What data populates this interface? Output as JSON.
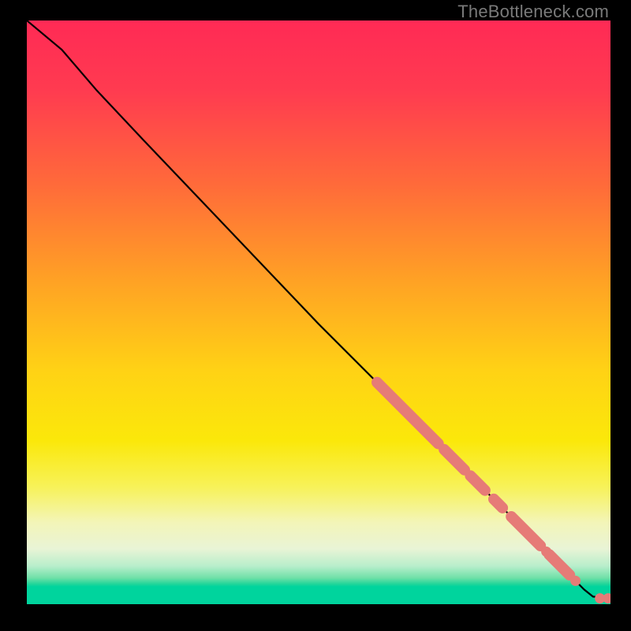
{
  "watermark": "TheBottleneck.com",
  "colors": {
    "gradient_stops": [
      {
        "offset": 0.0,
        "color": "#ff2a55"
      },
      {
        "offset": 0.12,
        "color": "#ff3b50"
      },
      {
        "offset": 0.28,
        "color": "#ff6a3a"
      },
      {
        "offset": 0.45,
        "color": "#ffa324"
      },
      {
        "offset": 0.6,
        "color": "#ffd215"
      },
      {
        "offset": 0.72,
        "color": "#fbe80a"
      },
      {
        "offset": 0.8,
        "color": "#f7f25a"
      },
      {
        "offset": 0.86,
        "color": "#f3f5b8"
      },
      {
        "offset": 0.905,
        "color": "#e9f4d6"
      },
      {
        "offset": 0.935,
        "color": "#b8eecb"
      },
      {
        "offset": 0.955,
        "color": "#6fe0a8"
      },
      {
        "offset": 0.965,
        "color": "#25d69a"
      },
      {
        "offset": 0.97,
        "color": "#00d49d"
      },
      {
        "offset": 1.0,
        "color": "#00d49d"
      }
    ],
    "curve": "#000000",
    "marker_fill": "#e67b77",
    "marker_stroke": "#c95a56"
  },
  "chart_data": {
    "type": "line",
    "title": "",
    "xlabel": "",
    "ylabel": "",
    "xlim": [
      0,
      100
    ],
    "ylim": [
      0,
      100
    ],
    "curve_points": [
      {
        "x": 0,
        "y": 100
      },
      {
        "x": 6,
        "y": 95
      },
      {
        "x": 12,
        "y": 88
      },
      {
        "x": 20,
        "y": 79.5
      },
      {
        "x": 30,
        "y": 69
      },
      {
        "x": 40,
        "y": 58.5
      },
      {
        "x": 50,
        "y": 48
      },
      {
        "x": 60,
        "y": 38
      },
      {
        "x": 70,
        "y": 28
      },
      {
        "x": 80,
        "y": 18
      },
      {
        "x": 88,
        "y": 10
      },
      {
        "x": 93,
        "y": 5
      },
      {
        "x": 95.5,
        "y": 2.5
      },
      {
        "x": 97,
        "y": 1.3
      },
      {
        "x": 100,
        "y": 1.0
      }
    ],
    "marker_segments": [
      {
        "x_start": 60,
        "x_end": 70.5,
        "y_start": 38,
        "y_end": 27.5
      },
      {
        "x_start": 71.5,
        "x_end": 75,
        "y_start": 26.5,
        "y_end": 23
      },
      {
        "x_start": 76,
        "x_end": 78.5,
        "y_start": 22,
        "y_end": 19.5
      },
      {
        "x_start": 80,
        "x_end": 81.5,
        "y_start": 18,
        "y_end": 16.5
      },
      {
        "x_start": 83,
        "x_end": 88,
        "y_start": 15,
        "y_end": 10
      },
      {
        "x_start": 89.5,
        "x_end": 93,
        "y_start": 8.5,
        "y_end": 5
      }
    ],
    "marker_dots": [
      {
        "x": 89.0,
        "y": 9.0
      },
      {
        "x": 94.0,
        "y": 4.0
      },
      {
        "x": 98.2,
        "y": 1.0
      },
      {
        "x": 99.6,
        "y": 1.0
      }
    ]
  }
}
